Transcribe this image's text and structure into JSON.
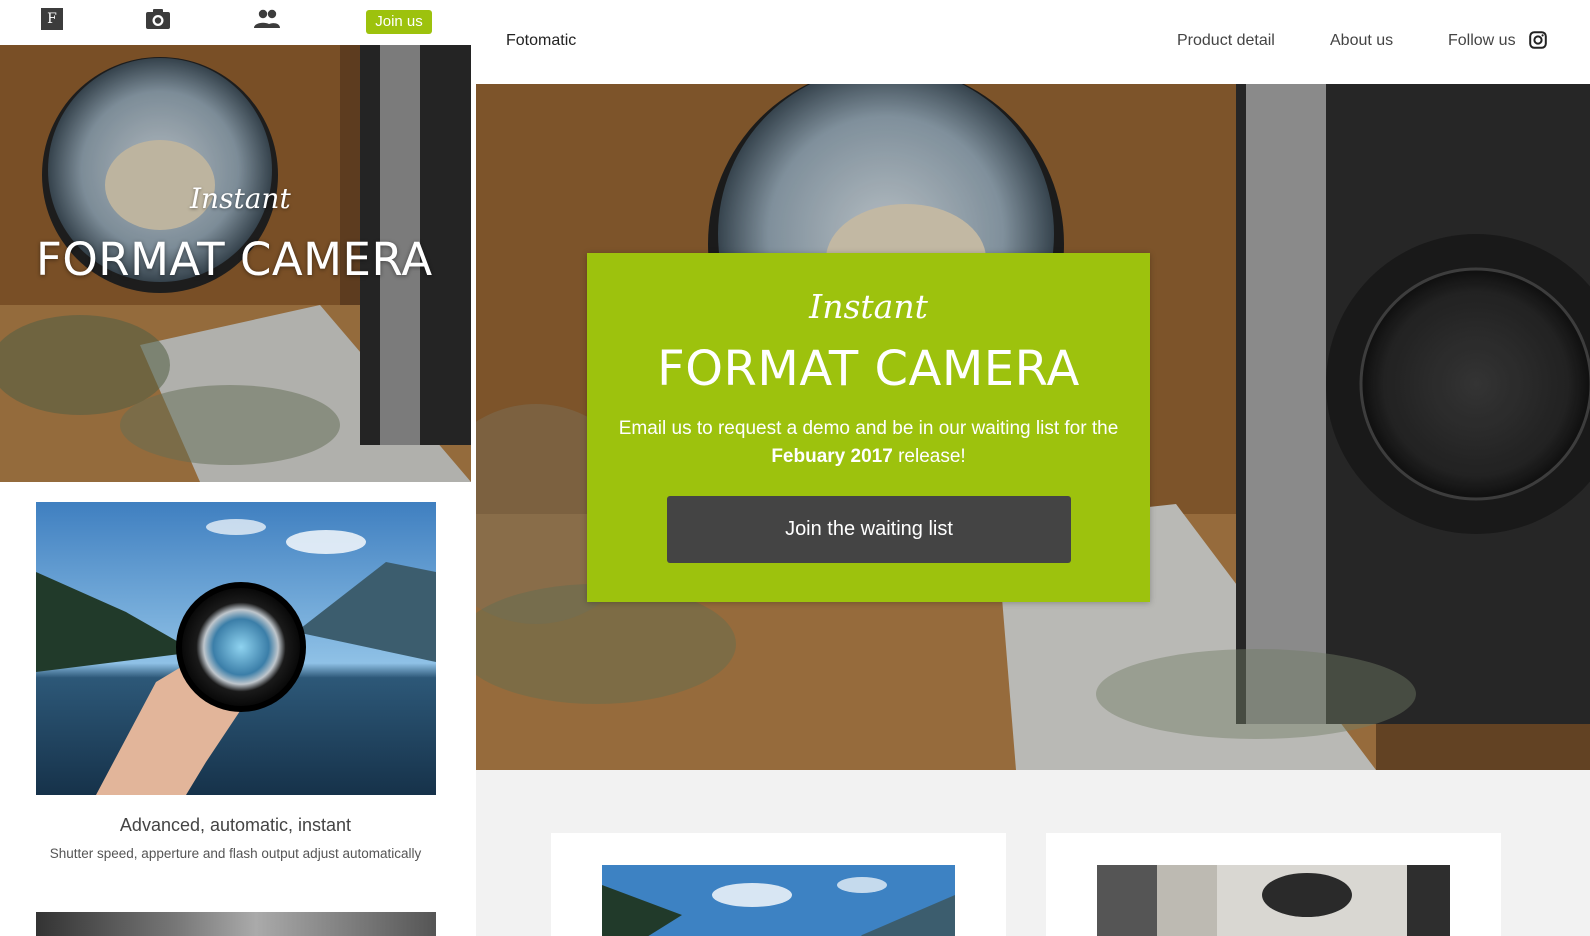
{
  "mobile": {
    "logo_letter": "F",
    "icons": [
      "camera-icon",
      "people-icon"
    ],
    "join_label": "Join us",
    "hero": {
      "script": "Instant",
      "title": "FORMAT CAMERA"
    },
    "card": {
      "title": "Advanced, automatic, instant",
      "subtitle": "Shutter speed, apperture and flash output adjust automatically"
    }
  },
  "desktop": {
    "nav": {
      "brand": "Fotomatic",
      "links": [
        "Product detail",
        "About us",
        "Follow us"
      ],
      "social_icon": "instagram-icon"
    },
    "hero_box": {
      "script": "Instant",
      "title": "FORMAT CAMERA",
      "text_before": "Email us to request a demo and be in our waiting list for the ",
      "text_bold": "Febuary 2017",
      "text_after": " release!",
      "button": "Join the waiting list"
    }
  },
  "colors": {
    "accent": "#9dc20d",
    "button_dark": "#444444",
    "page_bg": "#f2f2f2"
  }
}
